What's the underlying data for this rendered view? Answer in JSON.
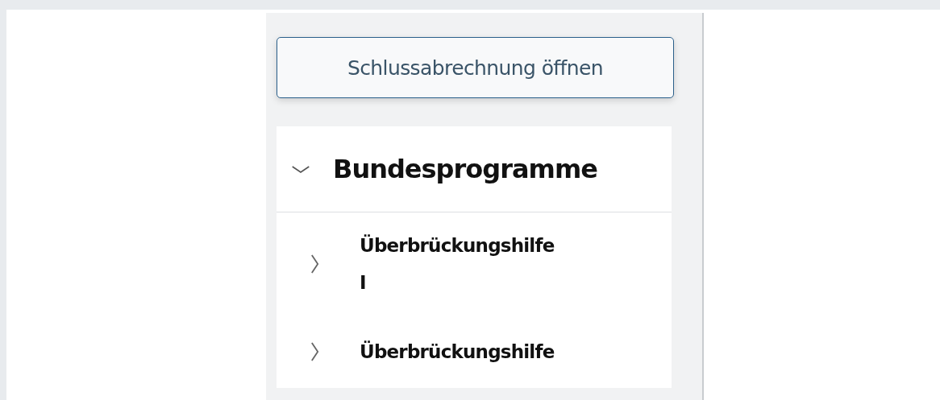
{
  "open_button": {
    "label": "Schlussabrechnung öffnen"
  },
  "section": {
    "title": "Bundesprogramme",
    "expanded": true,
    "items": [
      {
        "label": "Überbrückungshilfe I",
        "expanded": false
      },
      {
        "label": "Überbrückungshilfe",
        "expanded": false
      }
    ]
  }
}
